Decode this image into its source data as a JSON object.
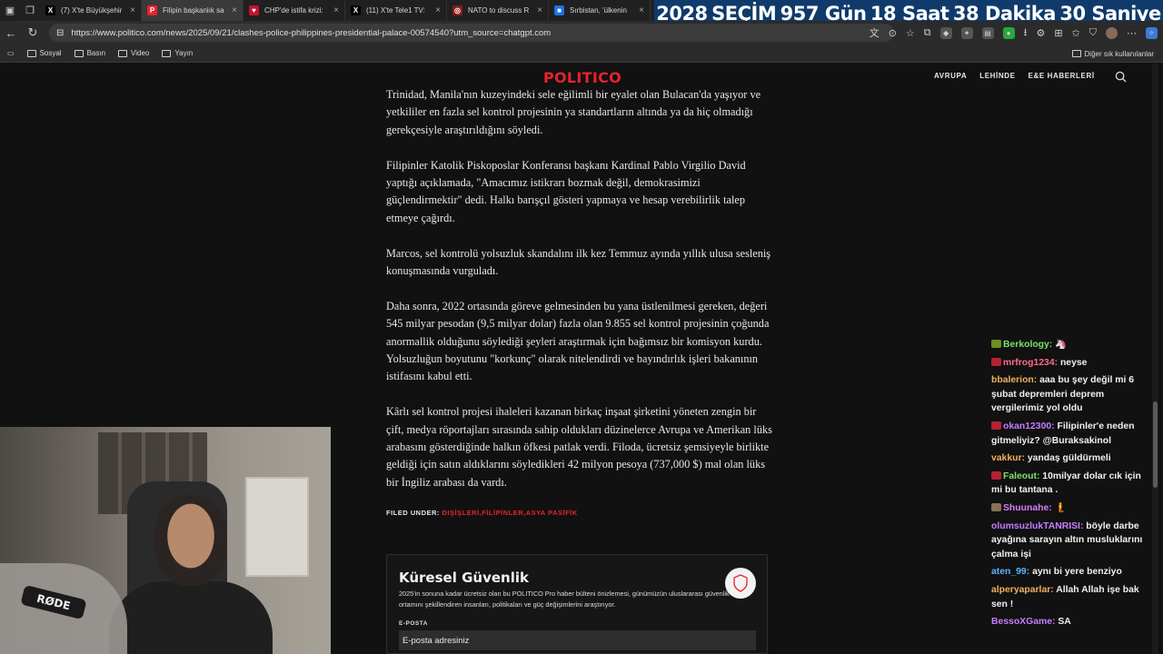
{
  "browser": {
    "tabs": [
      {
        "title": "(7) X'te Büyükşehir",
        "icon": "x-logo-icon",
        "fav_color": "#000000",
        "fav_char": "X"
      },
      {
        "title": "Filipin başkanlık sa",
        "icon": "politico-icon",
        "fav_color": "#e8222d",
        "fav_char": "P"
      },
      {
        "title": "CHP'de istifa krizi:",
        "icon": "tv-icon",
        "fav_color": "#c8102e",
        "fav_char": "♥"
      },
      {
        "title": "(11) X'te Tele1 TV:",
        "icon": "x-logo-icon",
        "fav_color": "#000000",
        "fav_char": "X"
      },
      {
        "title": "NATO to discuss R",
        "icon": "news-icon",
        "fav_color": "#8b1a1a",
        "fav_char": "◎"
      },
      {
        "title": "Sırbistan, 'ülkenin",
        "icon": "news-icon",
        "fav_color": "#1a73e8",
        "fav_char": "■"
      }
    ],
    "url": "https://www.politico.com/news/2025/09/21/clashes-police-philippines-presidential-palace-00574540?utm_source=chatgpt.com",
    "bookmarks": [
      "Sosyal",
      "Basın",
      "Video",
      "Yayın"
    ],
    "bookmarks_right": "Diğer sık kullanılanlar"
  },
  "countdown": {
    "year": "2028",
    "label": "SEÇİM",
    "days": "957 Gün",
    "hours": "18 Saat",
    "minutes": "38 Dakika",
    "seconds": "30 Saniye"
  },
  "site": {
    "logo": "POLITICO",
    "nav": [
      "AVRUPA",
      "LEHİNDE",
      "E&E HABERLERİ"
    ]
  },
  "article": {
    "paragraphs": [
      "Trinidad, Manila'nın kuzeyindeki sele eğilimli bir eyalet olan Bulacan'da yaşıyor ve yetkililer en fazla sel kontrol projesinin ya standartların altında ya da hiç olmadığı gerekçesiyle araştırıldığını söyledi.",
      "Filipinler Katolik Piskoposlar Konferansı başkanı Kardinal Pablo Virgilio David yaptığı açıklamada, \"Amacımız istikrarı bozmak değil, demokrasimizi güçlendirmektir\" dedi. Halkı barışçıl gösteri yapmaya ve hesap verebilirlik talep etmeye çağırdı.",
      "Marcos, sel kontrolü yolsuzluk skandalını ilk kez Temmuz ayında yıllık ulusa sesleniş konuşmasında vurguladı.",
      "Daha sonra, 2022 ortasında göreve gelmesinden bu yana üstlenilmesi gereken, değeri 545 milyar pesodan (9,5 milyar dolar) fazla olan 9.855 sel kontrol projesinin çoğunda anormallik olduğunu söylediği şeyleri araştırmak için bağımsız bir komisyon kurdu. Yolsuzluğun boyutunu \"korkunç\" olarak nitelendirdi ve bayındırlık işleri bakanının istifasını kabul etti.",
      "Kârlı sel kontrol projesi ihaleleri kazanan birkaç inşaat şirketini yöneten zengin bir çift, medya röportajları sırasında sahip oldukları düzinelerce Avrupa ve Amerikan lüks arabasını gösterdiğinde halkın öfkesi patlak verdi. Filoda, ücretsiz şemsiyeyle birlikte geldiği için satın aldıklarını söyledikleri 42 milyon pesoya (737,000 $) mal olan lüks bir İngiliz arabası da vardı."
    ],
    "filed_label": "FILED UNDER:",
    "filed_tags": "DIŞİŞLERİ,FİLİPİNLER,ASYA PASİFİK"
  },
  "newsletter": {
    "title": "Küresel Güvenlik",
    "description": "2025'in sonuna kadar ücretsiz olan bu POLITICO Pro haber bülteni önizlemesi, günümüzün uluslararası güvenlik ortamını şekillendiren insanları, politikaları ve güç değişimlerini araştırıyor.",
    "email_label": "E-POSTA",
    "email_placeholder": "E-posta adresiniz"
  },
  "webcam": {
    "mic_brand": "RØDE"
  },
  "chat": {
    "messages": [
      {
        "user": "Berkology:",
        "text": "🦄",
        "color": "#7fe06a",
        "badge": "#6b8e23"
      },
      {
        "user": "mrfrog1234:",
        "text": "neyse",
        "color": "#ff6b8a",
        "badge": "#b22234"
      },
      {
        "user": "bbalerion:",
        "text": "aaa bu şey değil mi 6 şubat depremleri deprem vergilerimiz yol oldu",
        "color": "#f0b060",
        "badge": ""
      },
      {
        "user": "okan12300:",
        "text": "Filipinler'e neden gitmeliyiz? @Buraksakinol",
        "color": "#c77dff",
        "badge": "#b22234"
      },
      {
        "user": "vakkur:",
        "text": "yandaş güldürmeli",
        "color": "#f0b060",
        "badge": ""
      },
      {
        "user": "Faleout:",
        "text": "10milyar dolar cık için mi bu tantana .",
        "color": "#7fe06a",
        "badge": "#b22234"
      },
      {
        "user": "Shuunahe:",
        "text": "🧜",
        "color": "#d67fff",
        "badge": "#8a6f5a"
      },
      {
        "user": "olumsuzlukTANRISI:",
        "text": "böyle darbe ayağına sarayın altın musluklarını çalma işi",
        "color": "#c77dff",
        "badge": ""
      },
      {
        "user": "aten_99:",
        "text": "aynı bi yere benziyo",
        "color": "#5fb4ff",
        "badge": ""
      },
      {
        "user": "alperyaparlar:",
        "text": "Allah Allah işe bak sen !",
        "color": "#f0b060",
        "badge": ""
      },
      {
        "user": "BessoXGame:",
        "text": "SA",
        "color": "#c77dff",
        "badge": ""
      }
    ]
  }
}
